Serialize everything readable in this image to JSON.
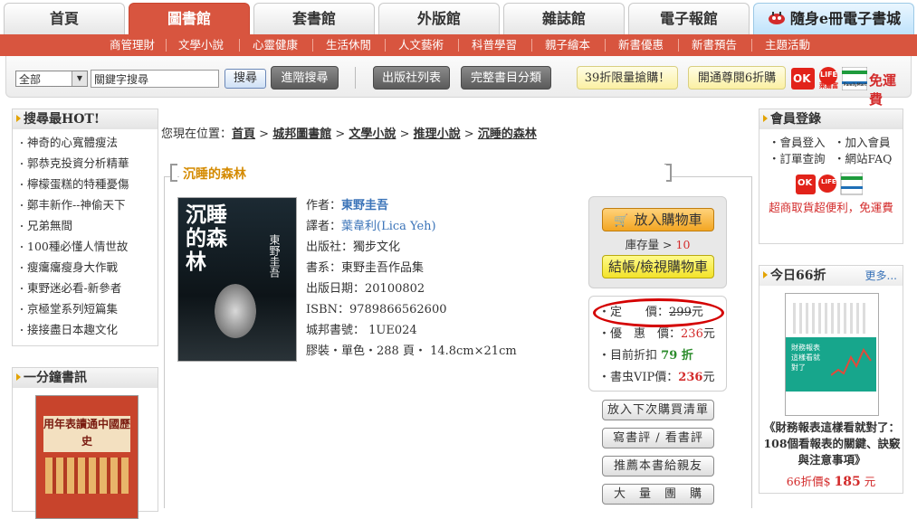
{
  "tabs": [
    "首頁",
    "圖書館",
    "套書館",
    "外版館",
    "雜誌館",
    "電子報館"
  ],
  "ebook_tab": "隨身e冊電子書城",
  "subnav": [
    "商管理財",
    "文學小說",
    "心靈健康",
    "生活休閒",
    "人文藝術",
    "科普學習",
    "親子繪本",
    "新書優惠",
    "新書預告",
    "主題活動"
  ],
  "search": {
    "select_value": "全部",
    "keyword": "關鍵字搜尋",
    "search_btn": "搜尋",
    "advanced_btn": "進階搜尋",
    "publishers_btn": "出版社列表",
    "catalog_btn": "完整書目分類",
    "promo1": "39折限量搶購！",
    "promo2": "開通尊閱6折購",
    "free_shipping": "免運費",
    "ok_label": "OK",
    "life_label": "LIFE",
    "life_sub": "萊爾富",
    "fm_label": "FamilyMart"
  },
  "hot": {
    "title": "搜尋最HOT!",
    "items": [
      "神奇的心寬體瘦法",
      "郭恭克投資分析精華",
      "檸檬蛋糕的特種憂傷",
      "鄭丰新作--神偷天下",
      "兄弟無間",
      "100種必懂人情世故",
      "瘦癟癟瘦身大作戰",
      "東野迷必看-新參者",
      "京極堂系列短篇集",
      "接接盡日本趣文化"
    ]
  },
  "minute": {
    "title": "一分鐘書訊",
    "cover_text": "用年表讀通中國歷史"
  },
  "breadcrumb": {
    "prefix": "您現在位置：",
    "items": [
      "首頁",
      "城邦圖書館",
      "文學小說",
      "推理小說",
      "沉睡的森林"
    ],
    "sep": ">"
  },
  "book": {
    "title": "沉睡的森林",
    "cover_title": "沉睡的森林",
    "cover_author": "東野圭吾",
    "author_label": "作者：",
    "author": "東野圭吾",
    "translator_label": "譯者：",
    "translator": "葉韋利(Lica Yeh)",
    "publisher": "出版社：獨步文化",
    "series": "書系：東野圭吾作品集",
    "pub_date": "出版日期：20100802",
    "isbn": "ISBN：9789866562600",
    "code": "城邦書號：  1UE024",
    "format": "膠裝・單色・288 頁・ 14.8cm×21cm"
  },
  "purchase": {
    "add_cart": "放入購物車",
    "stock_label": "庫存量 >",
    "stock": "10",
    "checkout": "結帳/檢視購物車",
    "list_price_label": "定　　價：",
    "list_price": "299",
    "currency": "元",
    "sale_label": "優　惠　價：",
    "sale_price": "236",
    "discount_label": "目前折扣",
    "discount": "79 折",
    "vip_label": "書虫VIP價：",
    "vip_price": "236"
  },
  "actions": [
    "放入下次購買清單",
    "寫書評 / 看書評",
    "推薦本書給親友",
    "大　量　團　購"
  ],
  "member": {
    "title": "會員登錄",
    "login": "會員登入",
    "join": "加入會員",
    "orders": "訂單查詢",
    "faq": "網站FAQ",
    "promo": "超商取貨超便利，免運費"
  },
  "today": {
    "title": "今日66折",
    "more": "更多...",
    "book_title": "《財務報表這樣看就對了：108個看報表的關鍵、訣竅與注意事項》",
    "price_label": "66折價$",
    "price": "185",
    "currency": "元",
    "cover_text": "財務報表這樣看就對了"
  },
  "colors": {
    "accent": "#d8553f",
    "link_blue": "#3a73b8",
    "price_red": "#d32b2b",
    "discount_green": "#2c8c2c",
    "circle": "#d40000"
  }
}
